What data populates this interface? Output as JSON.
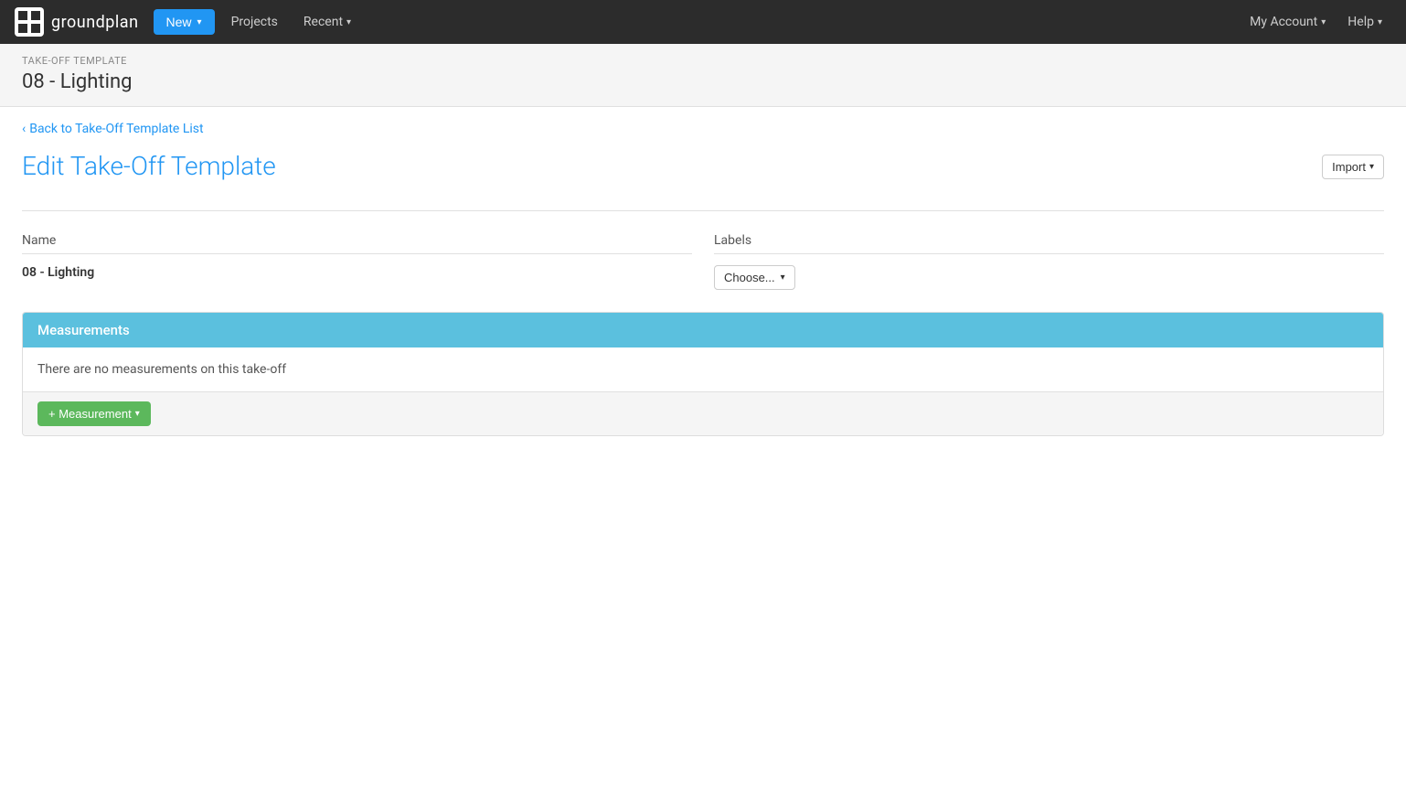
{
  "navbar": {
    "brand": "groundplan",
    "new_label": "New",
    "projects_label": "Projects",
    "recent_label": "Recent",
    "my_account_label": "My Account",
    "help_label": "Help"
  },
  "page_header": {
    "label": "Take-Off Template",
    "title": "08 - Lighting"
  },
  "back_link": {
    "text": "Back to Take-Off Template List"
  },
  "edit_section": {
    "title": "Edit Take-Off Template",
    "import_label": "Import"
  },
  "form": {
    "name_label": "Name",
    "name_value": "08 - Lighting",
    "labels_label": "Labels",
    "labels_placeholder": "Choose..."
  },
  "measurements": {
    "header": "Measurements",
    "empty_message": "There are no measurements on this take-off",
    "add_button": "+ Measurement"
  }
}
